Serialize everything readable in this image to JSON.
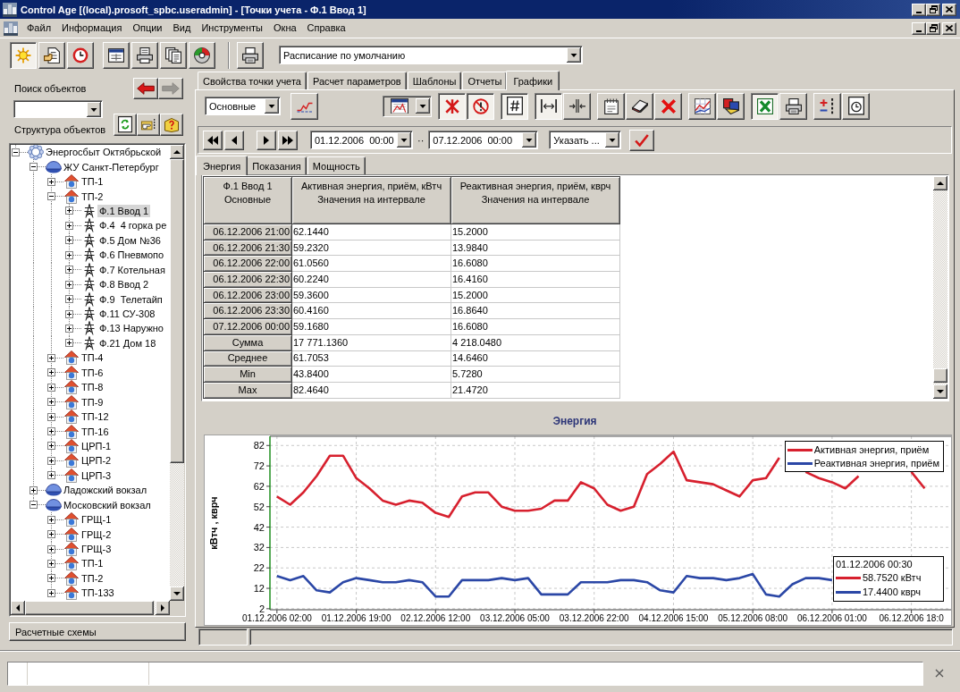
{
  "window": {
    "title": "Control Age [(local).prosoft_spbc.useradmin] - [Точки учета - Ф.1 Ввод 1]"
  },
  "menu": [
    "Файл",
    "Информация",
    "Опции",
    "Вид",
    "Инструменты",
    "Окна",
    "Справка"
  ],
  "toolbar": {
    "groups": [
      {
        "separated": false,
        "buttons": [
          {
            "kind": "sun",
            "pressed": true
          },
          {
            "kind": "document",
            "pressed": false
          },
          {
            "kind": "alarm_clock",
            "pressed": false
          }
        ]
      },
      {
        "separated": false,
        "buttons": [
          {
            "kind": "window",
            "pressed": false
          },
          {
            "kind": "tray",
            "pressed": false
          },
          {
            "kind": "pages",
            "pressed": false
          },
          {
            "kind": "disc",
            "pressed": false
          }
        ]
      },
      {
        "separated": true,
        "buttons": [
          {
            "kind": "printer",
            "pressed": false
          }
        ]
      }
    ],
    "schedule": "Расписание по умолчанию"
  },
  "object_search": {
    "label": "Поиск объектов",
    "nav": [
      {
        "kind": "back",
        "disabled": false
      },
      {
        "kind": "forward",
        "disabled": true
      }
    ]
  },
  "object_structure": {
    "label": "Структура объектов",
    "tools": [
      {
        "kind": "refresh"
      },
      {
        "kind": "pointer"
      },
      {
        "kind": "help_book"
      }
    ]
  },
  "tree": [
    {
      "label": "Энергосбыт Октябрьской",
      "kind": "company",
      "expanded": true,
      "selected": false,
      "children": [
        {
          "label": "ЖУ Санкт-Петербург",
          "kind": "division",
          "expanded": true,
          "selected": false,
          "children": [
            {
              "label": "ТП-1",
              "kind": "substation",
              "expanded": false,
              "selected": false
            },
            {
              "label": "ТП-2",
              "kind": "substation",
              "expanded": true,
              "selected": false,
              "children": [
                {
                  "label": "Ф.1 Ввод 1",
                  "kind": "feeder",
                  "expanded": false,
                  "selected": true
                },
                {
                  "label": "Ф.4  4 горка ре",
                  "kind": "feeder",
                  "expanded": false,
                  "selected": false
                },
                {
                  "label": "Ф.5 Дом №36",
                  "kind": "feeder",
                  "expanded": false,
                  "selected": false
                },
                {
                  "label": "Ф.6 Пневмопо",
                  "kind": "feeder",
                  "expanded": false,
                  "selected": false
                },
                {
                  "label": "Ф.7 Котельная",
                  "kind": "feeder",
                  "expanded": false,
                  "selected": false
                },
                {
                  "label": "Ф.8 Ввод 2",
                  "kind": "feeder",
                  "expanded": false,
                  "selected": false
                },
                {
                  "label": "Ф.9  Телетайп",
                  "kind": "feeder",
                  "expanded": false,
                  "selected": false
                },
                {
                  "label": "Ф.11 СУ-308",
                  "kind": "feeder",
                  "expanded": false,
                  "selected": false
                },
                {
                  "label": "Ф.13 Наружно",
                  "kind": "feeder",
                  "expanded": false,
                  "selected": false
                },
                {
                  "label": "Ф.21 Дом 18",
                  "kind": "feeder",
                  "expanded": false,
                  "selected": false
                }
              ]
            },
            {
              "label": "ТП-4",
              "kind": "substation",
              "expanded": false,
              "selected": false
            },
            {
              "label": "ТП-6",
              "kind": "substation",
              "expanded": false,
              "selected": false
            },
            {
              "label": "ТП-8",
              "kind": "substation",
              "expanded": false,
              "selected": false
            },
            {
              "label": "ТП-9",
              "kind": "substation",
              "expanded": false,
              "selected": false
            },
            {
              "label": "ТП-12",
              "kind": "substation",
              "expanded": false,
              "selected": false
            },
            {
              "label": "ТП-16",
              "kind": "substation",
              "expanded": false,
              "selected": false
            },
            {
              "label": "ЦРП-1",
              "kind": "substation",
              "expanded": false,
              "selected": false
            },
            {
              "label": "ЦРП-2",
              "kind": "substation",
              "expanded": false,
              "selected": false
            },
            {
              "label": "ЦРП-3",
              "kind": "substation",
              "expanded": false,
              "selected": false
            }
          ]
        },
        {
          "label": "Ладожский вокзал",
          "kind": "division",
          "expanded": false,
          "selected": false
        },
        {
          "label": "Московский вокзал",
          "kind": "division",
          "expanded": true,
          "selected": false,
          "children": [
            {
              "label": "ГРЩ-1",
              "kind": "substation",
              "expanded": false,
              "selected": false
            },
            {
              "label": "ГРЩ-2",
              "kind": "substation",
              "expanded": false,
              "selected": false
            },
            {
              "label": "ГРЩ-3",
              "kind": "substation",
              "expanded": false,
              "selected": false
            },
            {
              "label": "ТП-1",
              "kind": "substation",
              "expanded": false,
              "selected": false
            },
            {
              "label": "ТП-2",
              "kind": "substation",
              "expanded": false,
              "selected": false
            },
            {
              "label": "ТП-133",
              "kind": "substation",
              "expanded": false,
              "selected": false
            }
          ]
        }
      ]
    }
  ],
  "schemes_panel": {
    "label": "Расчетные схемы"
  },
  "tabs": [
    {
      "label": "Свойства точки учета",
      "selected": false
    },
    {
      "label": "Расчет параметров",
      "selected": false
    },
    {
      "label": "Шаблоны",
      "selected": false
    },
    {
      "label": "Отчеты",
      "selected": false
    },
    {
      "label": "Графики",
      "selected": true
    }
  ],
  "chart_toolbar": {
    "view": "Основные",
    "groups": [
      [
        {
          "kind": "line_chart",
          "pressed": false
        }
      ],
      [
        {
          "kind": "chart_type_menu"
        }
      ],
      [
        {
          "kind": "asterisk",
          "pressed": true
        },
        {
          "kind": "no_entry",
          "pressed": true
        }
      ],
      [
        {
          "kind": "hash",
          "pressed": true
        }
      ],
      [
        {
          "kind": "fit_width",
          "pressed": true
        },
        {
          "kind": "squeeze",
          "pressed": false
        }
      ],
      [
        {
          "kind": "notepad",
          "pressed": false
        },
        {
          "kind": "eraser",
          "pressed": false
        },
        {
          "kind": "delete",
          "pressed": false
        }
      ],
      [
        {
          "kind": "grid_chart",
          "pressed": false
        },
        {
          "kind": "palette",
          "pressed": false
        }
      ],
      [
        {
          "kind": "spreadsheet",
          "pressed": true
        },
        {
          "kind": "printer",
          "pressed": false
        }
      ],
      [
        {
          "kind": "plus_minus",
          "pressed": false
        },
        {
          "kind": "clock_page",
          "pressed": false
        }
      ]
    ]
  },
  "period": {
    "from": "01.12.2006  00:00",
    "separator": "··",
    "to": "07.12.2006  00:00",
    "range": "Указать ..."
  },
  "subtabs": [
    {
      "label": "Энергия",
      "selected": true
    },
    {
      "label": "Показания",
      "selected": false
    },
    {
      "label": "Мощность",
      "selected": false
    }
  ],
  "table": {
    "columns": [
      {
        "title": "Ф.1 Ввод 1",
        "subtitle": "Основные"
      },
      {
        "title": "Активная энергия, приём, кВтч",
        "subtitle": "Значения на интервале"
      },
      {
        "title": "Реактивная энергия, приём, кврч",
        "subtitle": "Значения на интервале"
      }
    ],
    "rows": [
      {
        "kind": "interval",
        "label": "06.12.2006 21:00",
        "values": [
          "62.1440",
          "15.2000"
        ]
      },
      {
        "kind": "interval",
        "label": "06.12.2006 21:30",
        "values": [
          "59.2320",
          "13.9840"
        ]
      },
      {
        "kind": "interval",
        "label": "06.12.2006 22:00",
        "values": [
          "61.0560",
          "16.6080"
        ]
      },
      {
        "kind": "interval",
        "label": "06.12.2006 22:30",
        "values": [
          "60.2240",
          "16.4160"
        ]
      },
      {
        "kind": "interval",
        "label": "06.12.2006 23:00",
        "values": [
          "59.3600",
          "15.2000"
        ]
      },
      {
        "kind": "interval",
        "label": "06.12.2006 23:30",
        "values": [
          "60.4160",
          "16.8640"
        ]
      },
      {
        "kind": "interval",
        "label": "07.12.2006 00:00",
        "values": [
          "59.1680",
          "16.6080"
        ]
      },
      {
        "kind": "summary",
        "label": "Сумма",
        "values": [
          "17 771.1360",
          "4 218.0480"
        ]
      },
      {
        "kind": "summary",
        "label": "Среднее",
        "values": [
          "61.7053",
          "14.6460"
        ]
      },
      {
        "kind": "summary",
        "label": "Min",
        "values": [
          "43.8400",
          "5.7280"
        ]
      },
      {
        "kind": "summary",
        "label": "Max",
        "values": [
          "82.4640",
          "21.4720"
        ]
      }
    ]
  },
  "chart": {
    "chart_data": {
      "type": "line",
      "title": "Энергия",
      "ylabel": "кВтч , кврч",
      "grid": true,
      "legend": true,
      "categories": [
        "01.12.2006 02:00",
        null,
        null,
        null,
        null,
        null,
        "01.12.2006 19:00",
        null,
        null,
        null,
        null,
        null,
        "02.12.2006 12:00",
        null,
        null,
        null,
        null,
        null,
        "03.12.2006 05:00",
        null,
        null,
        null,
        null,
        null,
        "03.12.2006 22:00",
        null,
        null,
        null,
        null,
        null,
        "04.12.2006 15:00",
        null,
        null,
        null,
        null,
        null,
        "05.12.2006 08:00",
        null,
        null,
        null,
        null,
        null,
        "06.12.2006 01:00",
        null,
        null,
        null,
        null,
        null,
        "06.12.2006 18:0",
        null
      ],
      "ylim": [
        1.5,
        86.5
      ],
      "yticks": [
        2,
        12,
        22,
        32,
        42,
        52,
        62,
        72,
        82
      ],
      "series": [
        {
          "name": "Активная энергия, приём",
          "color": "#d7202e",
          "values": [
            57,
            53,
            59,
            67,
            77,
            77,
            66,
            61,
            55,
            53,
            55,
            54,
            49,
            47,
            57,
            59,
            59,
            52,
            50,
            50,
            51,
            55,
            55,
            64,
            61,
            53,
            50,
            52,
            68,
            73,
            79,
            65,
            64,
            63,
            60,
            57,
            65,
            66,
            76,
            null,
            69,
            66,
            64,
            61,
            67,
            null,
            null,
            null,
            69,
            61
          ]
        },
        {
          "name": "Реактивная энергия, приём",
          "color": "#2b47a6",
          "values": [
            18,
            16,
            18,
            11,
            10,
            15,
            17,
            16,
            15,
            15,
            16,
            15,
            8,
            8,
            16,
            16,
            16,
            17,
            16,
            17,
            9,
            9,
            9,
            15,
            15,
            15,
            16,
            16,
            15,
            11,
            10,
            18,
            17,
            17,
            16,
            17,
            19,
            9,
            8,
            14,
            17,
            17,
            16,
            null,
            null,
            null,
            null,
            null,
            null,
            null
          ]
        }
      ]
    },
    "cursor": {
      "time": "01.12.2006 00:30",
      "readings": [
        "58.7520 кВтч",
        "17.4400 кврч"
      ]
    }
  }
}
